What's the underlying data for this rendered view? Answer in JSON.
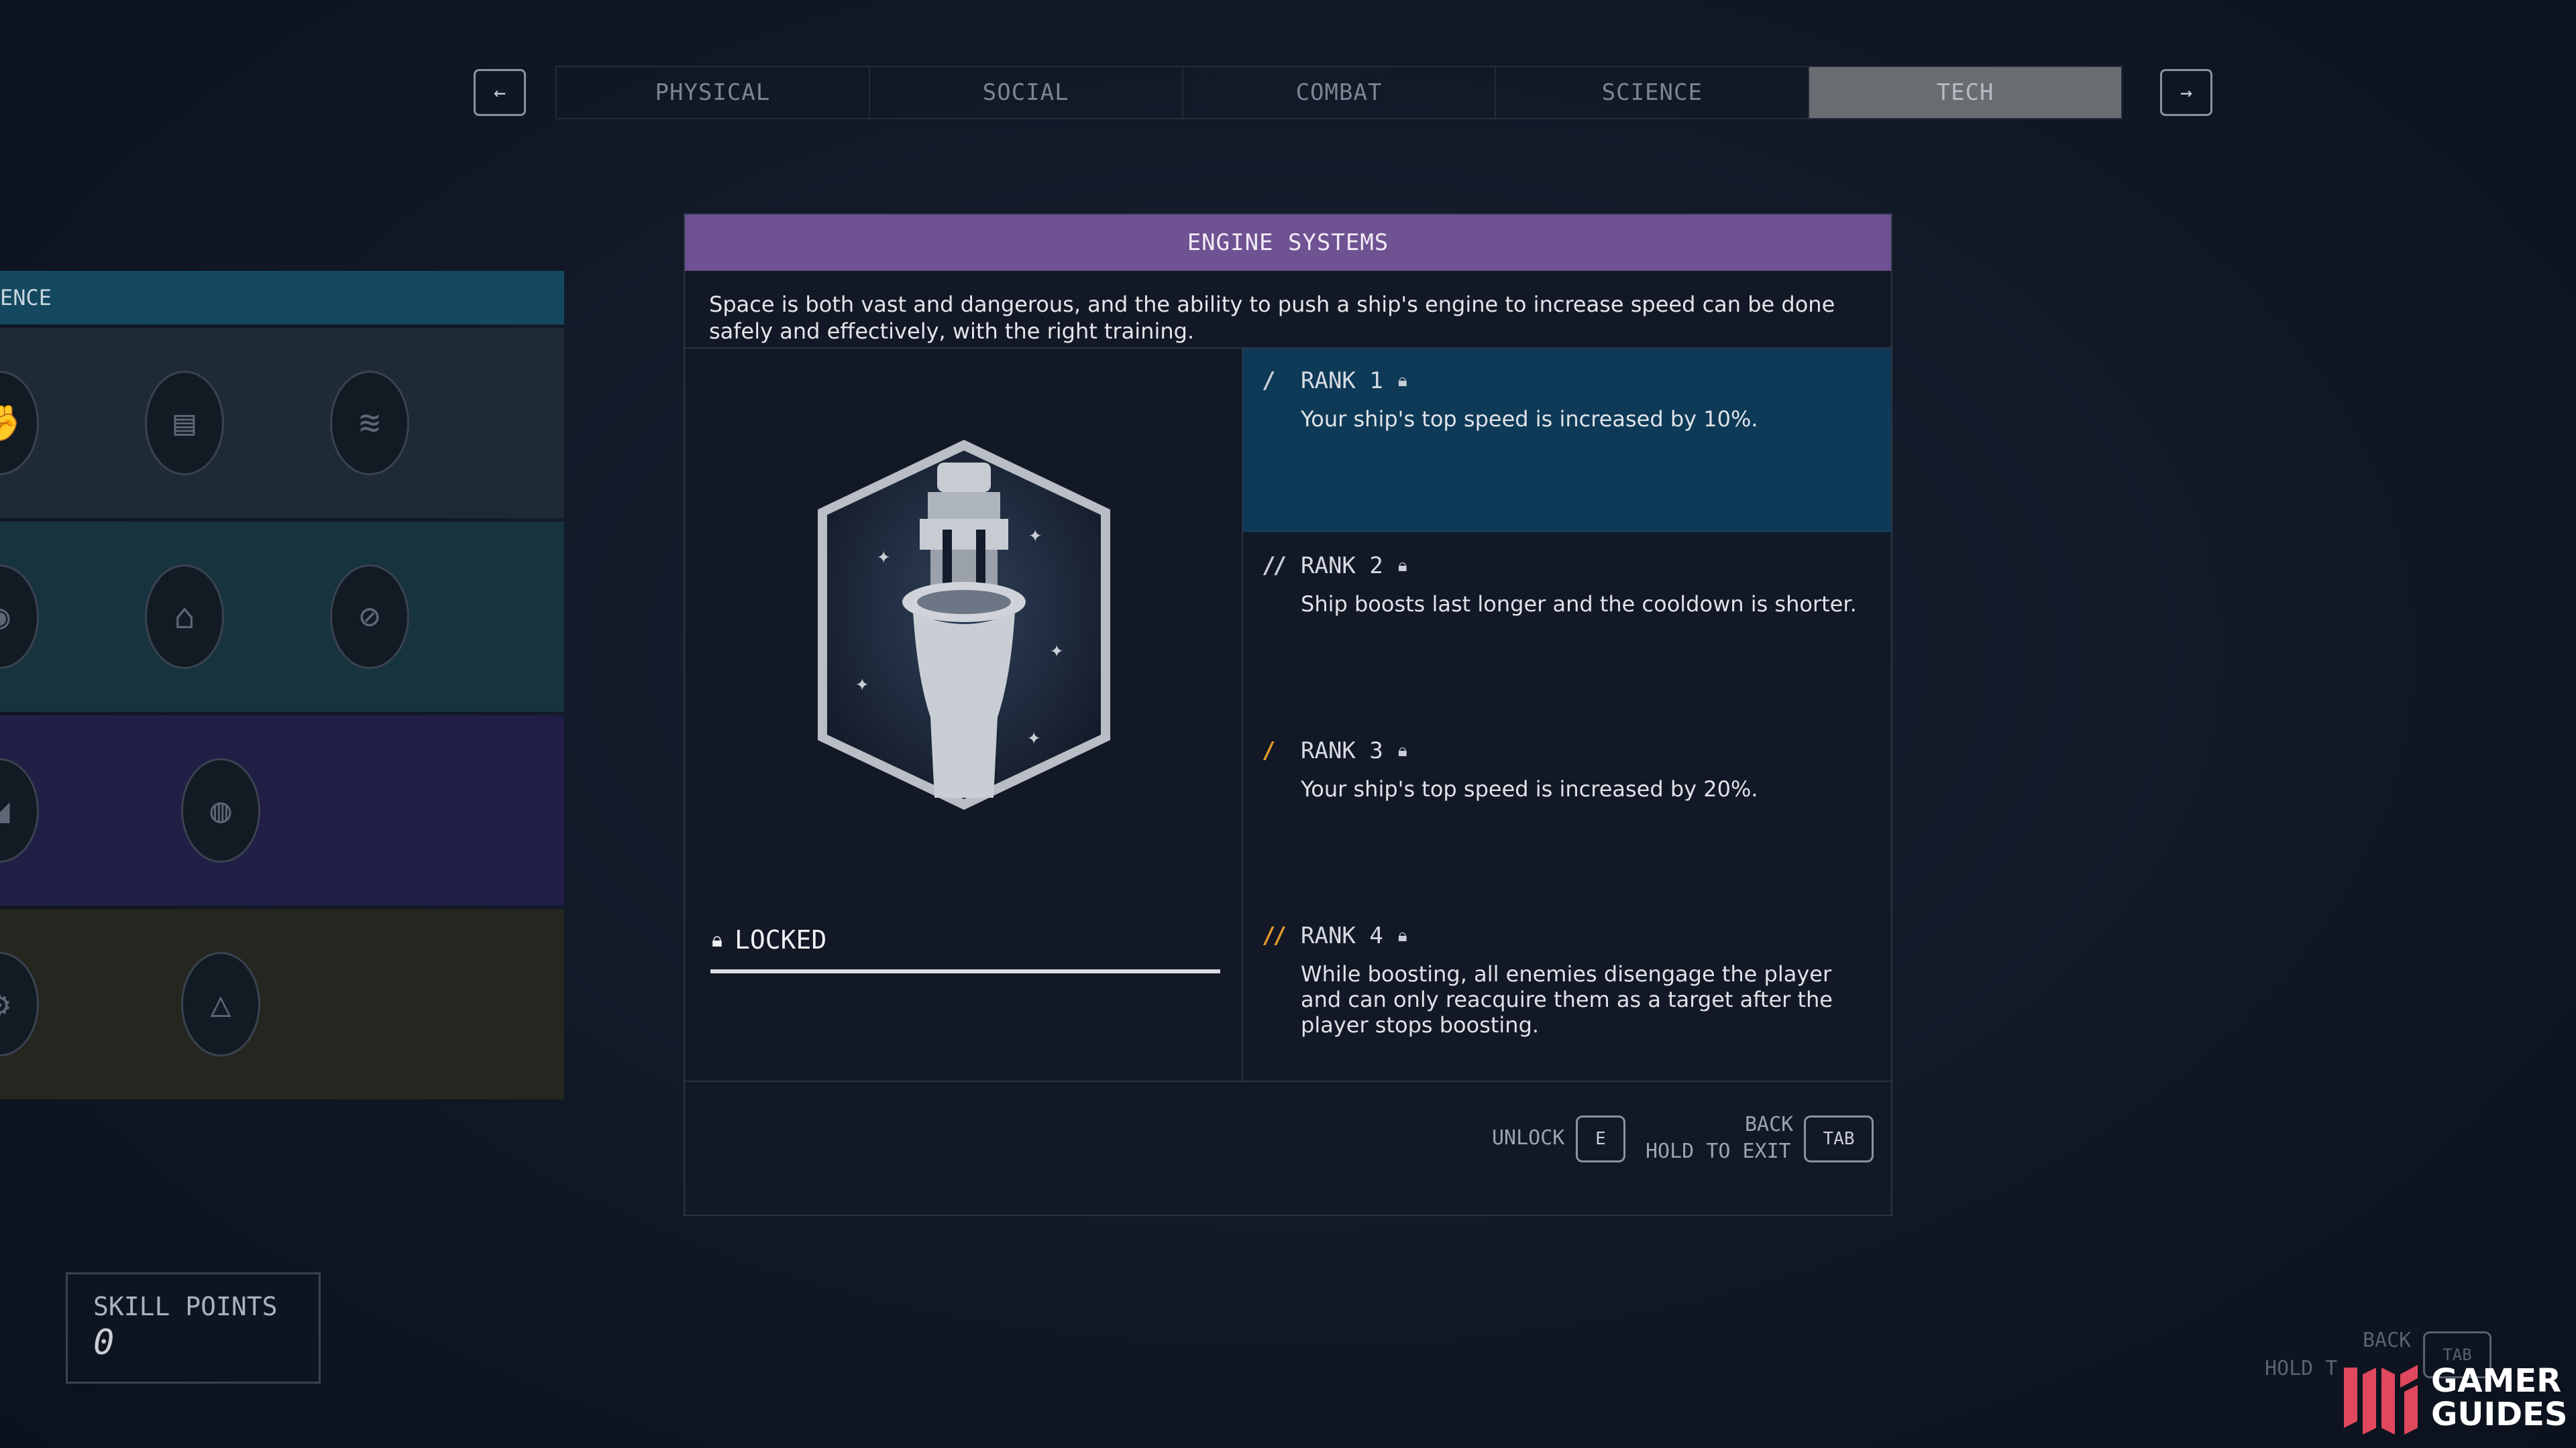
{
  "nav": {
    "prev_icon": "←",
    "next_icon": "→",
    "tabs": [
      {
        "label": "PHYSICAL"
      },
      {
        "label": "SOCIAL"
      },
      {
        "label": "COMBAT"
      },
      {
        "label": "SCIENCE"
      },
      {
        "label": "TECH",
        "active": true
      }
    ]
  },
  "tree": {
    "header": "ENCE"
  },
  "skill": {
    "title": "ENGINE SYSTEMS",
    "description": "Space is both vast and dangerous, and the ability to push a ship's engine to increase speed can be done safely and effectively, with the right training.",
    "status": "LOCKED",
    "ranks": [
      {
        "label": "RANK 1",
        "text": "Your ship's top speed is increased by 10%."
      },
      {
        "label": "RANK 2",
        "text": "Ship boosts last longer and the cooldown is shorter."
      },
      {
        "label": "RANK 3",
        "text": "Your ship's top speed is increased by 20%."
      },
      {
        "label": "RANK 4",
        "text": "While boosting, all enemies disengage the player and can only reacquire them as a target after the player stops boosting."
      }
    ]
  },
  "controls": {
    "unlock_label": "UNLOCK",
    "unlock_key": "E",
    "back_label": "BACK",
    "hold_label": "HOLD TO EXIT",
    "back_key": "TAB"
  },
  "skill_points": {
    "label": "SKILL POINTS",
    "value": "0"
  },
  "ghost": {
    "back": "BACK",
    "hold": "HOLD T",
    "key": "TAB"
  },
  "watermark": {
    "line1": "GAMER",
    "line2": "GUIDES"
  },
  "colors": {
    "panel_header": "#6f5291",
    "current_rank": "#0e3a57",
    "rank_marker_orange": "#e39a2a"
  }
}
